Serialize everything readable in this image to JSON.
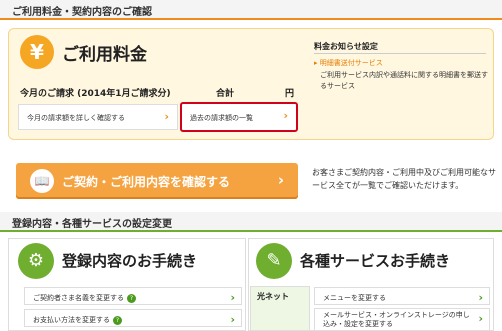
{
  "sections": {
    "top_title": "ご利用料金・契約内容のご確認",
    "settings_title": "登録内容・各種サービスの設定変更"
  },
  "billing": {
    "icon_glyph": "¥",
    "title": "ご利用料金",
    "month_label": "今月のご請求 (2014年1月ご請求分)",
    "total_label": "合計",
    "unit": "円",
    "detail_button": "今月の請求額を詳しく確認する",
    "past_button": "過去の請求額の一覧",
    "arrow": "›"
  },
  "notice": {
    "title": "料金お知らせ設定",
    "link": "▸ 明細書送付サービス",
    "description": "ご利用サービス内訳や通話料に関する明細書を郵送するサービス"
  },
  "contract": {
    "button_label": "ご契約・ご利用内容を確認する",
    "icon_glyph": "📖",
    "arrow": "›",
    "description": "お客さまご契約内容・ご利用中及びご利用可能なサービス全てが一覧でご確認いただけます。"
  },
  "registration": {
    "title": "登録内容のお手続き",
    "icon_glyph": "⚙",
    "items": [
      {
        "label": "ご契約者さま名義を変更する",
        "help": "?"
      },
      {
        "label": "お支払い方法を変更する",
        "help": "?"
      }
    ]
  },
  "services": {
    "title": "各種サービスお手続き",
    "icon_glyph": "✎",
    "category": "光ネット",
    "items": [
      {
        "label": "メニューを変更する"
      },
      {
        "label": "メールサービス・オンラインストレージの申し込み・設定を変更する"
      }
    ]
  },
  "colors": {
    "accent_orange": "#f08c1e",
    "accent_green": "#6fae2e",
    "highlight_red": "#d0021b"
  }
}
